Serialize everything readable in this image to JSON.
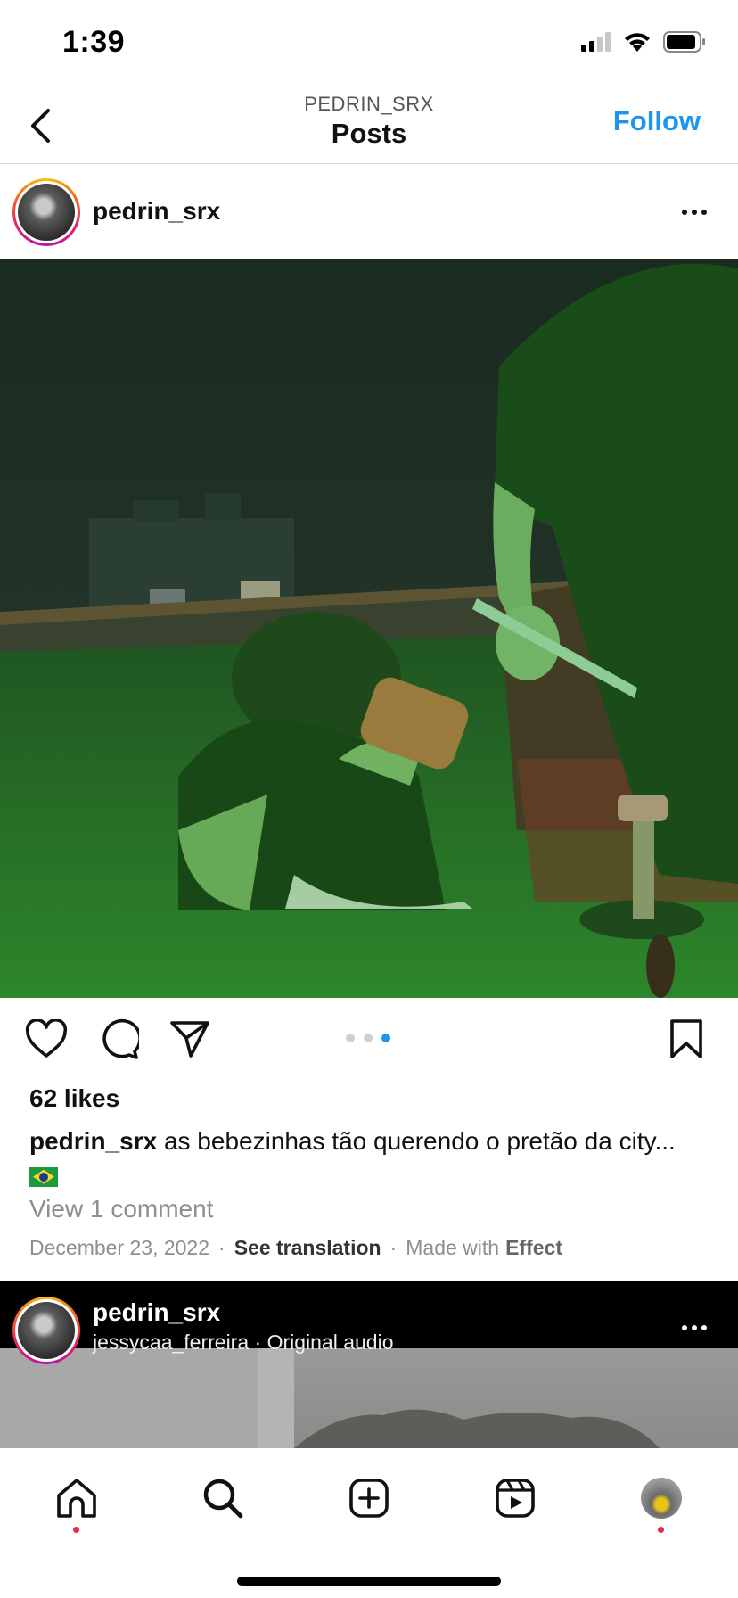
{
  "status_bar": {
    "time": "1:39",
    "icons": [
      "signal-icon",
      "wifi-icon",
      "battery-icon"
    ]
  },
  "header": {
    "subtitle": "PEDRIN_SRX",
    "title": "Posts",
    "follow_label": "Follow",
    "back_icon": "chevron-left-icon"
  },
  "post": {
    "username": "pedrin_srx",
    "more_icon": "more-horizontal-icon",
    "photo_icon": "post-photo",
    "actions": [
      "heart-icon",
      "comment-icon",
      "share-icon",
      "bookmark-icon"
    ],
    "carousel": {
      "count": 3,
      "active_index": 2
    },
    "likes": "62 likes",
    "caption_user": "pedrin_srx",
    "caption_text": " as bebezinhas tão querendo o pretão da city...",
    "caption_emoji": "brazil-flag",
    "view_comments": "View 1 comment",
    "date": "December 23, 2022",
    "see_translation": "See translation",
    "made_with": "Made with",
    "effect": "Effect"
  },
  "post2": {
    "username": "pedrin_srx",
    "audio": "jessycaa_ferreira · Original audio"
  },
  "bottom_nav": {
    "items": [
      "home-icon",
      "search-icon",
      "create-icon",
      "reels-icon",
      "profile-avatar"
    ],
    "notification_color": "#ef2845"
  },
  "colors": {
    "accent": "#1b95f0",
    "photo_tint": "#2e8a2e"
  }
}
